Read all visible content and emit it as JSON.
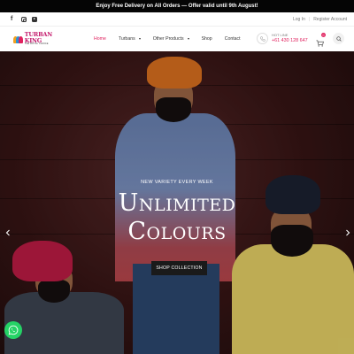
{
  "promo": {
    "text": "Enjoy Free Delivery on All Orders — Offer valid until 9th August!"
  },
  "topbar": {
    "social": [
      "facebook-icon",
      "instagram-icon",
      "youtube-icon"
    ],
    "login": "Log In",
    "register": "Register Account"
  },
  "brand": {
    "name": "TURBAN KING",
    "tagline": "THE ROYAL CHOICE"
  },
  "nav": {
    "items": [
      {
        "label": "Home",
        "active": true
      },
      {
        "label": "Turbans",
        "dropdown": true
      },
      {
        "label": "Other Products",
        "dropdown": true
      },
      {
        "label": "Shop"
      },
      {
        "label": "Contact"
      }
    ]
  },
  "hotline": {
    "label": "HOT LINE",
    "number": "+61 430 128 647"
  },
  "cart": {
    "count": "0"
  },
  "hero": {
    "kicker": "NEW VARIETY EVERY WEEK",
    "title_line1": "Unlimited",
    "title_line2": "Colours",
    "cta": "SHOP COLLECTION"
  },
  "colors": {
    "accent": "#e0215e",
    "brand": "#c3186b",
    "promo_bg": "#050505",
    "whatsapp": "#25d366"
  }
}
